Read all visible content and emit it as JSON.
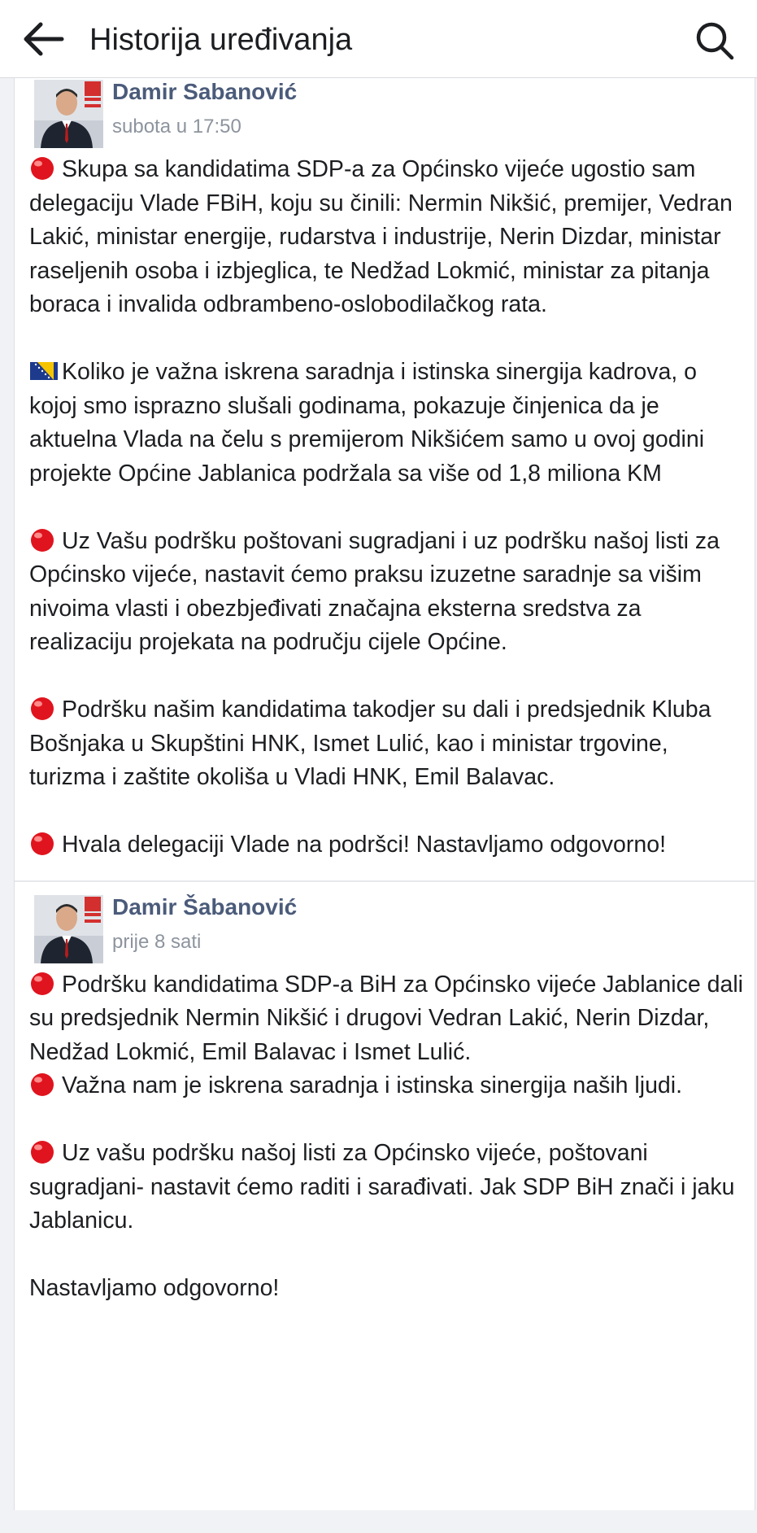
{
  "header": {
    "title": "Historija uređivanja",
    "back_icon": "arrow-left-icon",
    "search_icon": "search-icon"
  },
  "entries": [
    {
      "author": "Damir Sabanović",
      "time": "subota u 17:50",
      "paragraphs": [
        {
          "icon": "red-circle",
          "text": "Skupa sa kandidatima SDP-a za Općinsko vijeće ugostio sam delegaciju Vlade FBiH, koju su činili: Nermin Nikšić, premijer, Vedran Lakić, ministar energije, rudarstva i industrije, Nerin Dizdar, ministar raseljenih osoba i izbjeglica, te Nedžad Lokmić, ministar za pitanja boraca i invalida odbrambeno-oslobodilačkog rata."
        },
        {
          "icon": "bih-flag",
          "text": "Koliko je važna iskrena saradnja i istinska sinergija kadrova, o kojoj smo isprazno slušali godinama, pokazuje činjenica da je aktuelna Vlada na čelu s premijerom Nikšićem samo u ovoj godini projekte Općine Jablanica podržala sa više od 1,8 miliona KM"
        },
        {
          "icon": "red-circle",
          "text": "Uz Vašu podršku poštovani sugradjani i uz podršku našoj listi za Općinsko vijeće, nastavit ćemo praksu izuzetne saradnje sa višim nivoima vlasti i obezbjeđivati značajna eksterna sredstva za realizaciju projekata na području cijele Općine."
        },
        {
          "icon": "red-circle",
          "text": "Podršku našim kandidatima takodjer su dali i predsjednik Kluba Bošnjaka u Skupštini HNK, Ismet Lulić, kao i ministar trgovine, turizma i zaštite okoliša u Vladi HNK, Emil Balavac."
        },
        {
          "icon": "red-circle",
          "text": "Hvala delegaciji Vlade na podršci! Nastavljamo odgovorno!"
        }
      ]
    },
    {
      "author": "Damir Šabanović",
      "time": "prije 8 sati",
      "paragraphs": [
        {
          "icon": "red-circle",
          "text": "Podršku kandidatima SDP-a BiH za Općinsko vijeće Jablanice dali su predsjednik Nermin Nikšić i drugovi Vedran Lakić, Nerin Dizdar, Nedžad Lokmić, Emil Balavac i Ismet Lulić."
        },
        {
          "icon": "red-circle",
          "text": "Važna nam je iskrena saradnja i istinska sinergija naših ljudi."
        },
        {
          "icon": "red-circle",
          "text": "Uz vašu podršku našoj listi za Općinsko vijeće, poštovani sugradjani- nastavit ćemo raditi i sarađivati. Jak SDP BiH znači i jaku Jablanicu."
        },
        {
          "icon": "",
          "text": "Nastavljamo odgovorno!"
        }
      ]
    }
  ],
  "colors": {
    "author": "#4b5b7a",
    "time": "#8d949e",
    "text": "#1c1e21",
    "bullet_red": "#e0141e",
    "background": "#f0f2f5"
  }
}
